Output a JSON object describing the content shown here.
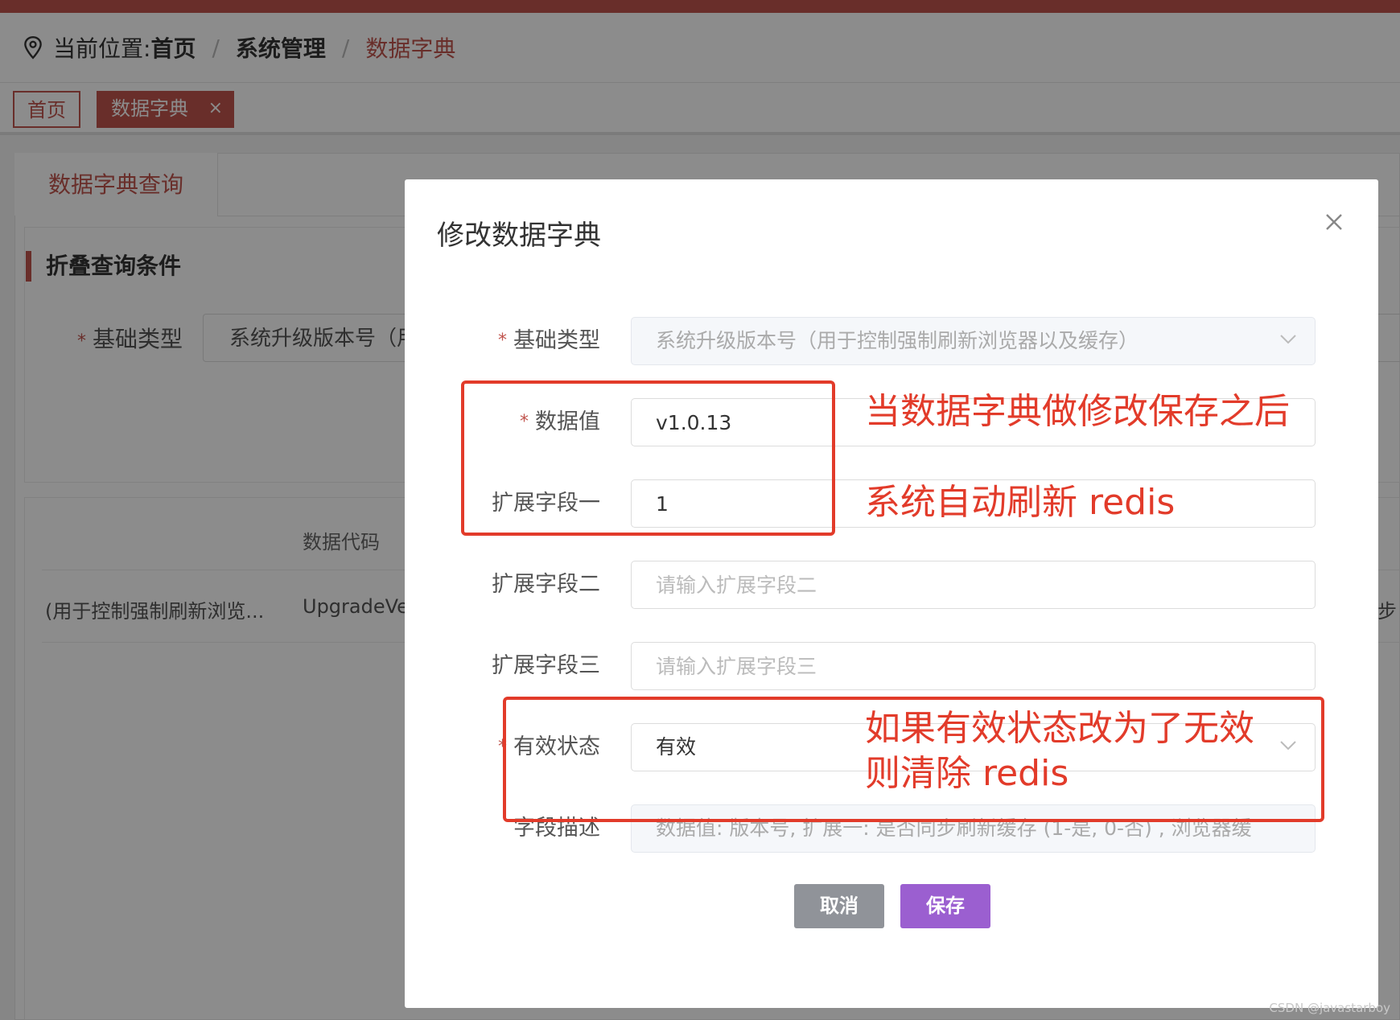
{
  "breadcrumb": {
    "prefix": "当前位置:",
    "items": [
      "首页",
      "系统管理",
      "数据字典"
    ],
    "separator": "/"
  },
  "tabs": [
    {
      "label": "首页"
    },
    {
      "label": "数据字典",
      "close": "×"
    }
  ],
  "background": {
    "tab_label": "数据字典查询",
    "section_title": "折叠查询条件",
    "base_type_label": "基础类型",
    "base_type_value": "系统升级版本号（用",
    "table_header": "数据代码",
    "row_cells": [
      "(用于控制强制刷新浏览...",
      "UpgradeVer",
      "步"
    ]
  },
  "modal": {
    "title": "修改数据字典",
    "fields": {
      "base_type": {
        "label": "基础类型",
        "value": "系统升级版本号（用于控制强制刷新浏览器以及缓存）"
      },
      "data_value": {
        "label": "数据值",
        "value": "v1.0.13"
      },
      "ext1": {
        "label": "扩展字段一",
        "value": "1"
      },
      "ext2": {
        "label": "扩展字段二",
        "placeholder": "请输入扩展字段二"
      },
      "ext3": {
        "label": "扩展字段三",
        "placeholder": "请输入扩展字段三"
      },
      "status": {
        "label": "有效状态",
        "value": "有效"
      },
      "desc": {
        "label": "字段描述",
        "value": "数据值: 版本号, 扩展一: 是否同步刷新缓存 (1-是, 0-否) , 浏览器缓"
      }
    },
    "cancel_label": "取消",
    "save_label": "保存"
  },
  "annotations": {
    "line1": "当数据字典做修改保存之后",
    "line2": "系统自动刷新 redis",
    "line3": "如果有效状态改为了无效",
    "line4": "则清除 redis",
    "color": "#e23b2a"
  },
  "watermark": "CSDN @javastarboy",
  "colors": {
    "accent": "#c0544d",
    "save": "#9b5fd0",
    "cancel": "#909399"
  }
}
